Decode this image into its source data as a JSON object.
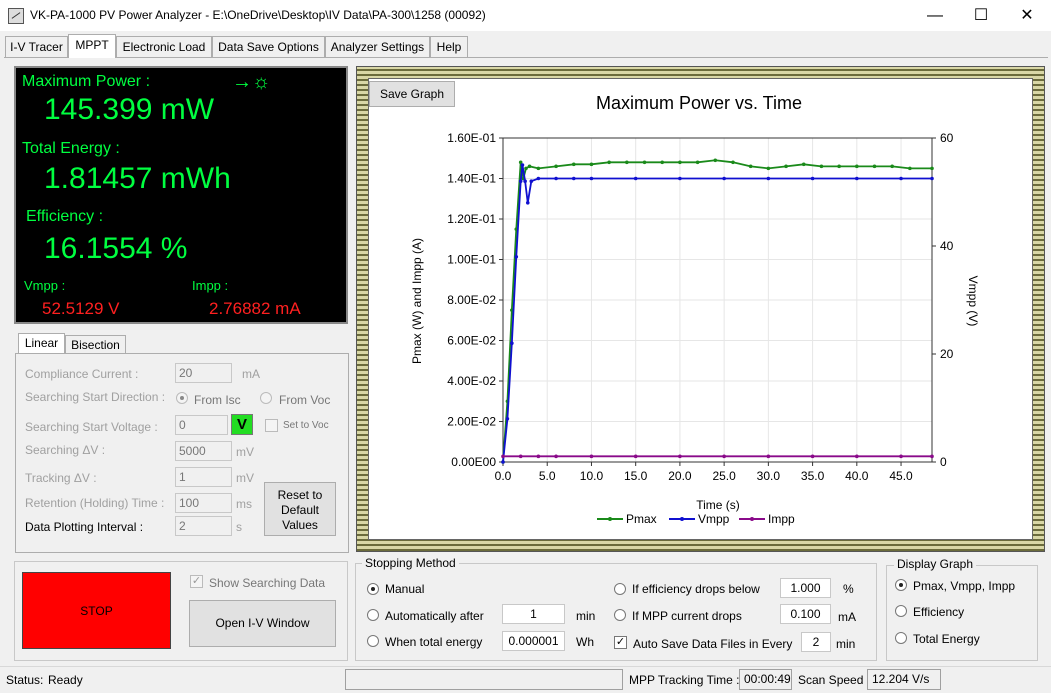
{
  "window": {
    "title": "VK-PA-1000 PV Power Analyzer - E:\\OneDrive\\Desktop\\IV Data\\PA-300\\1258 (00092)",
    "minimize": "—",
    "maximize": "☐",
    "close": "✕"
  },
  "tabs": [
    "I-V Tracer",
    "MPPT",
    "Electronic Load",
    "Data Save Options",
    "Analyzer Settings",
    "Help"
  ],
  "display": {
    "max_power_label": "Maximum Power :",
    "max_power_value": "145.399 mW",
    "energy_label": "Total Energy :",
    "energy_value": "1.81457 mWh",
    "efficiency_label": "Efficiency :",
    "efficiency_value": "16.1554 %",
    "vmpp_label": "Vmpp :",
    "vmpp_value": "52.5129 V",
    "impp_label": "Impp :",
    "impp_value": "2.76882 mA"
  },
  "subtabs": [
    "Linear",
    "Bisection"
  ],
  "settings": {
    "compliance_label": "Compliance Current :",
    "compliance_value": "20",
    "compliance_unit": "mA",
    "direction_label": "Searching Start Direction :",
    "from_isc": "From Isc",
    "from_voc": "From Voc",
    "start_voltage_label": "Searching Start Voltage :",
    "start_voltage_value": "0",
    "v_button": "V",
    "set_to_voc": "Set to Voc",
    "search_dv_label": "Searching ΔV :",
    "search_dv_value": "5000",
    "search_dv_unit": "mV",
    "track_dv_label": "Tracking ΔV :",
    "track_dv_value": "1",
    "track_dv_unit": "mV",
    "retention_label": "Retention (Holding) Time :",
    "retention_value": "100",
    "retention_unit": "ms",
    "plot_interval_label": "Data Plotting Interval :",
    "plot_interval_value": "2",
    "plot_interval_unit": "s",
    "reset_button": "Reset to Default Values"
  },
  "controls": {
    "stop_button": "STOP",
    "show_searching": "Show Searching Data",
    "open_iv": "Open I-V Window"
  },
  "graph": {
    "save_button": "Save Graph"
  },
  "chart_data": {
    "type": "line",
    "title": "Maximum Power vs. Time",
    "xlabel": "Time (s)",
    "ylabel": "Pmax (W) and Impp (A)",
    "y2label": "Vmpp (V)",
    "xlim": [
      0,
      48.5
    ],
    "ylim": [
      0,
      0.16
    ],
    "y2lim": [
      0,
      60
    ],
    "x_ticks": [
      "0.0",
      "5.0",
      "10.0",
      "15.0",
      "20.0",
      "25.0",
      "30.0",
      "35.0",
      "40.0",
      "45.0"
    ],
    "y_ticks": [
      "0.00E00",
      "2.00E-02",
      "4.00E-02",
      "6.00E-02",
      "8.00E-02",
      "1.00E-01",
      "1.20E-01",
      "1.40E-01",
      "1.60E-01"
    ],
    "y2_ticks": [
      "0",
      "20",
      "40",
      "60"
    ],
    "grid": true,
    "legend": "bottom",
    "series": [
      {
        "name": "Pmax",
        "axis": "left",
        "color": "#1a8a1a",
        "x": [
          0,
          0.5,
          1.0,
          1.5,
          2.0,
          2.3,
          2.6,
          3,
          4,
          6,
          8,
          10,
          12,
          14,
          16,
          18,
          20,
          22,
          24,
          26,
          28,
          30,
          32,
          34,
          36,
          38,
          40,
          42,
          44,
          46,
          48.5
        ],
        "y": [
          0,
          0.03,
          0.075,
          0.115,
          0.148,
          0.14,
          0.145,
          0.146,
          0.145,
          0.146,
          0.147,
          0.147,
          0.148,
          0.148,
          0.148,
          0.148,
          0.148,
          0.148,
          0.149,
          0.148,
          0.146,
          0.145,
          0.146,
          0.147,
          0.146,
          0.146,
          0.146,
          0.146,
          0.146,
          0.145,
          0.145
        ]
      },
      {
        "name": "Vmpp",
        "axis": "right",
        "color": "#1010d0",
        "x": [
          0,
          0.5,
          1.0,
          1.5,
          2.0,
          2.2,
          2.5,
          2.8,
          3.2,
          4,
          6,
          8,
          10,
          15,
          20,
          25,
          30,
          35,
          40,
          45,
          48.5
        ],
        "y": [
          0,
          8,
          22,
          38,
          52,
          55,
          52,
          48,
          52,
          52.5,
          52.5,
          52.5,
          52.5,
          52.5,
          52.5,
          52.5,
          52.5,
          52.5,
          52.5,
          52.5,
          52.5
        ]
      },
      {
        "name": "Impp",
        "axis": "left",
        "color": "#8a0a8a",
        "x": [
          0,
          2,
          4,
          6,
          10,
          15,
          20,
          25,
          30,
          35,
          40,
          45,
          48.5
        ],
        "y": [
          0.0028,
          0.0028,
          0.0028,
          0.0028,
          0.0028,
          0.0028,
          0.0028,
          0.0028,
          0.0028,
          0.0028,
          0.0028,
          0.0028,
          0.0028
        ]
      }
    ]
  },
  "stopping": {
    "title": "Stopping Method",
    "manual": "Manual",
    "auto_after": "Automatically after",
    "auto_after_value": "1",
    "auto_after_unit": "min",
    "when_energy": "When total energy",
    "energy_value": "0.000001",
    "energy_unit": "Wh",
    "eff_drops": "If efficiency drops below",
    "eff_value": "1.000",
    "eff_unit": "%",
    "mpp_drops": "If MPP current drops",
    "mpp_value": "0.100",
    "mpp_unit": "mA",
    "auto_save": "Auto Save Data Files in Every",
    "auto_save_value": "2",
    "auto_save_unit": "min"
  },
  "display_graph": {
    "title": "Display Graph",
    "opt1": "Pmax, Vmpp, Impp",
    "opt2": "Efficiency",
    "opt3": "Total Energy"
  },
  "status": {
    "label": "Status:",
    "value": "Ready",
    "tracking_label": "MPP Tracking Time :",
    "tracking_value": "00:00:49",
    "scan_label": "Scan Speed :",
    "scan_value": "12.204 V/s"
  }
}
